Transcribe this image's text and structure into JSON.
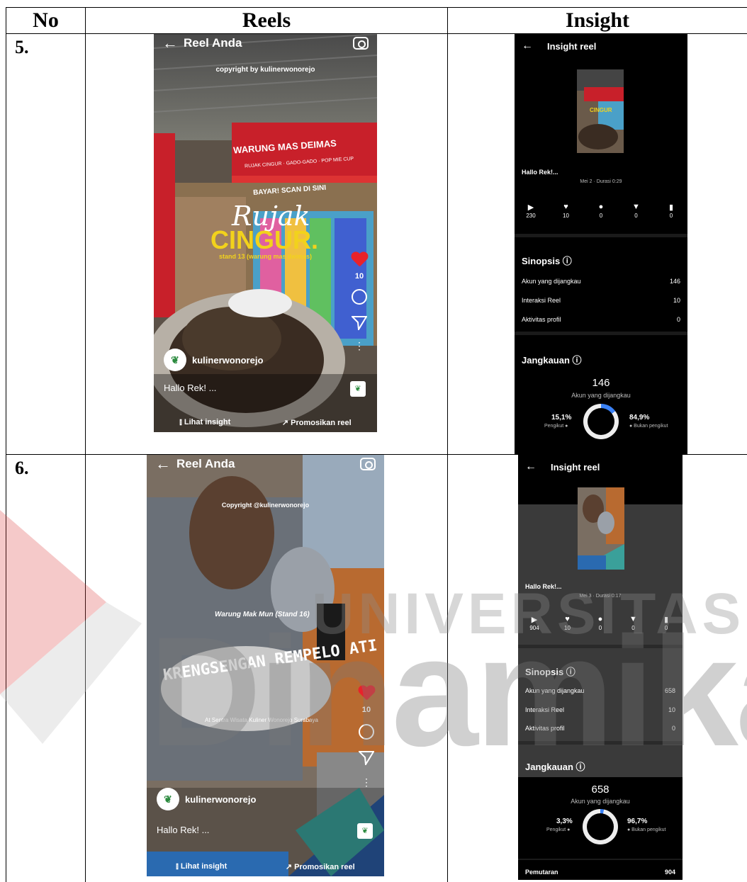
{
  "table": {
    "headers": [
      "No",
      "Reels",
      "Insight"
    ],
    "rows": [
      {
        "no": "5.",
        "reel": {
          "title": "Reel Anda",
          "copyright": "copyright by kulinerwonorejo",
          "sign_top": "WARUNG MAS DEIMAS",
          "sign_sub": "RUJAK CINGUR · GADO-GADO · POP MIE CUP",
          "sign_scan": "BAYAR! SCAN DI SINI",
          "overlay_script": "Rujak",
          "overlay_big": "CINGUR.",
          "overlay_small": "stand 13 (warung mas deimas)",
          "likes": "10",
          "username": "kulinerwonorejo",
          "caption": "Hallo Rek! ...",
          "lihat": "Lihat insight",
          "promosikan": "Promosikan reel"
        },
        "insight": {
          "title": "Insight reel",
          "hallo": "Hallo Rek!...",
          "meta": "Mei 2 · Durasi 0:29",
          "stats": [
            "230",
            "10",
            "0",
            "0",
            "0"
          ],
          "sinopsis": "Sinopsis ⓘ",
          "rows": [
            {
              "label": "Akun yang dijangkau",
              "value": "146"
            },
            {
              "label": "Interaksi Reel",
              "value": "10"
            },
            {
              "label": "Aktivitas profil",
              "value": "0"
            }
          ],
          "jangkauan": "Jangkauan ⓘ",
          "reach": "146",
          "reach_label": "Akun yang dijangkau",
          "left_pct": "15,1%",
          "left_label": "Pengikut ●",
          "right_pct": "84,9%",
          "right_label": "● Bukan pengikut",
          "follower_fraction": 0.151
        }
      },
      {
        "no": "6.",
        "reel": {
          "title": "Reel Anda",
          "copyright": "Copyright @kulinerwonorejo",
          "stand": "Warung Mak Mun (Stand 16)",
          "overlay_big": "KRENGSENGAN REMPELO ATI",
          "location": "At Sentra Wisata Kuliner Wonorejo Surabaya",
          "likes": "10",
          "username": "kulinerwonorejo",
          "caption": "Hallo Rek! ...",
          "lihat": "Lihat insight",
          "promosikan": "Promosikan reel"
        },
        "insight": {
          "title": "Insight reel",
          "hallo": "Hallo Rek!...",
          "meta": "Mei 3 · Durasi 0:17",
          "stats": [
            "904",
            "10",
            "0",
            "0",
            "0"
          ],
          "sinopsis": "Sinopsis ⓘ",
          "rows": [
            {
              "label": "Akun yang dijangkau",
              "value": "658"
            },
            {
              "label": "Interaksi Reel",
              "value": "10"
            },
            {
              "label": "Aktivitas profil",
              "value": "0"
            }
          ],
          "jangkauan": "Jangkauan ⓘ",
          "reach": "658",
          "reach_label": "Akun yang dijangkau",
          "left_pct": "3,3%",
          "left_label": "Pengikut ●",
          "right_pct": "96,7%",
          "right_label": "● Bukan pengikut",
          "follower_fraction": 0.033,
          "pemutaran_label": "Pemutaran",
          "pemutaran_value": "904"
        }
      }
    ]
  },
  "watermark": {
    "word1": "UNIVERSITAS",
    "word2": "Dinamika"
  }
}
